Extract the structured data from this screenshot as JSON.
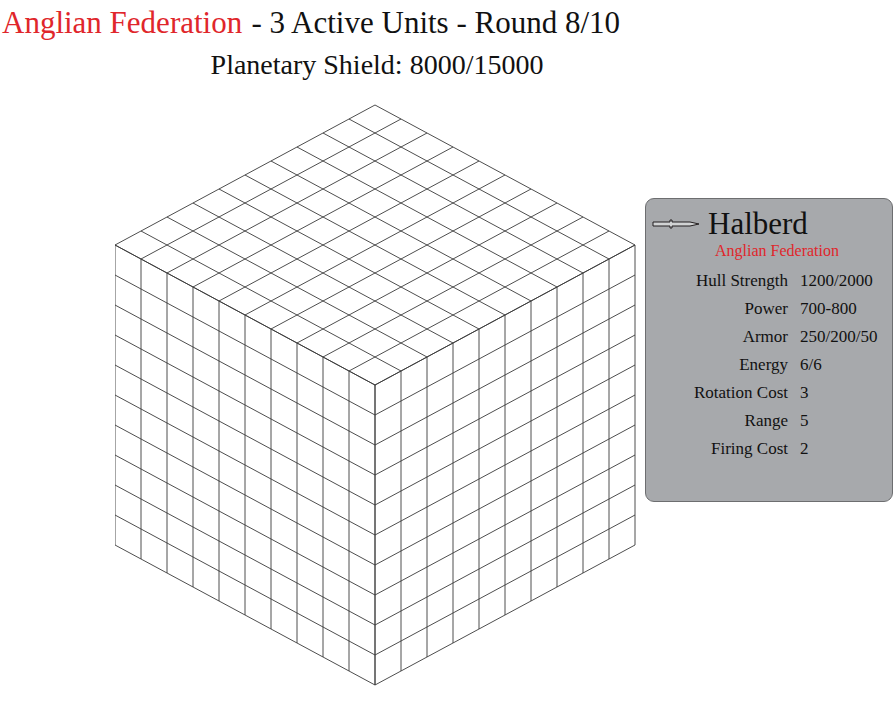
{
  "header": {
    "faction": "Anglian Federation",
    "summary": "- 3 Active Units - Round 8/10",
    "shield": "Planetary Shield: 8000/15000"
  },
  "unit": {
    "name": "Halberd",
    "faction": "Anglian Federation",
    "stats": [
      {
        "label": "Hull Strength",
        "value": "1200/2000"
      },
      {
        "label": "Power",
        "value": "700-800"
      },
      {
        "label": "Armor",
        "value": "250/200/50"
      },
      {
        "label": "Energy",
        "value": "6/6"
      },
      {
        "label": "Rotation Cost",
        "value": "3"
      },
      {
        "label": "Range",
        "value": "5"
      },
      {
        "label": "Firing Cost",
        "value": "2"
      }
    ]
  }
}
